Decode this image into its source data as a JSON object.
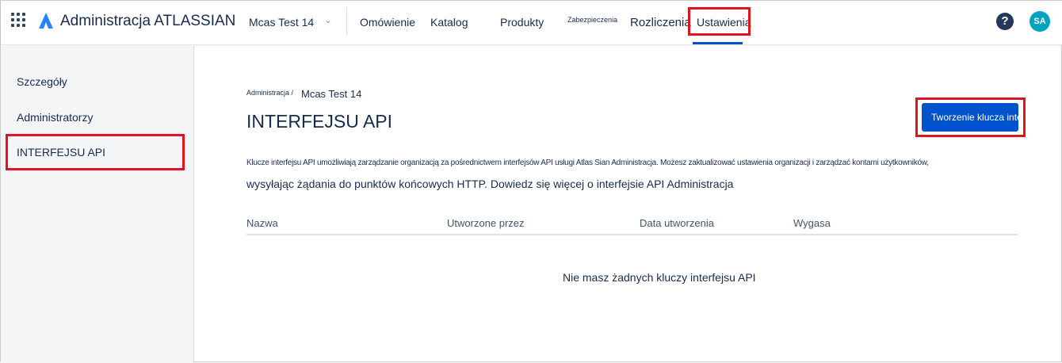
{
  "header": {
    "app_title": "Administracja ATLASSIAN",
    "org": "Mcas Test 14",
    "nav": [
      "Omówienie",
      "Katalog",
      "Produkty",
      "Zabezpieczenia",
      "Rozliczenia",
      "Ustawienia"
    ],
    "avatar": "SA",
    "help": "?"
  },
  "sidebar": {
    "items": [
      "Szczegóły",
      "Administratorzy",
      "INTERFEJSU API"
    ]
  },
  "main": {
    "breadcrumb_root": "Administracja /",
    "breadcrumb_current": "Mcas Test 14",
    "title": "INTERFEJSU API",
    "create_button": "Tworzenie klucza interfejsu API",
    "description_1": "Klucze interfejsu API umożliwiają zarządzanie organizacją za pośrednictwem interfejsów API usługi Atlas Sian Administracja. Możesz zaktualizować ustawienia organizacji i zarządzać kontami użytkowników,",
    "description_2": "wysyłając żądania do punktów końcowych HTTP. Dowiedz się więcej o interfejsie API Administracja",
    "columns": [
      "Nazwa",
      "Utworzone przez",
      "Data utworzenia",
      "Wygasa"
    ],
    "empty": "Nie masz żadnych kluczy interfejsu API"
  }
}
